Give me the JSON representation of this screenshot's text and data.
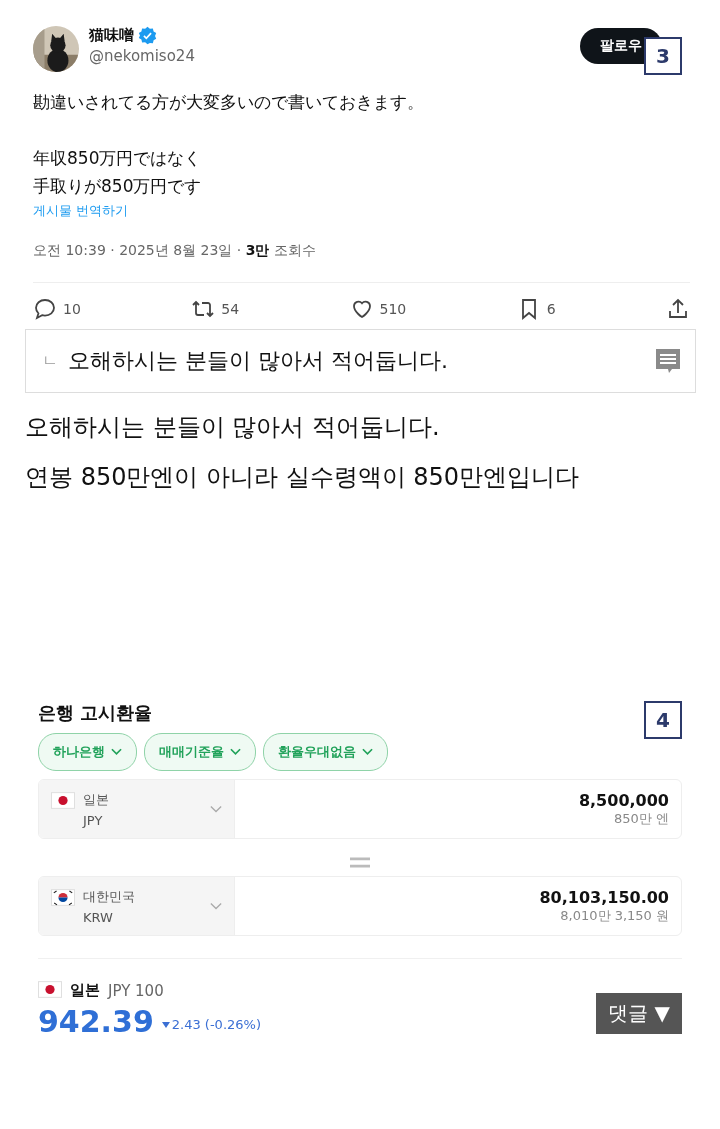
{
  "tweet": {
    "name": "猫味噌",
    "verified": true,
    "handle": "@nekomiso24",
    "follow_button": "팔로우",
    "image_number": "3",
    "body_paragraphs": [
      [
        "勘違いされてる方が大変多いので書いておきます。"
      ],
      [
        "年収850万円ではなく",
        "手取りが850万円です"
      ]
    ],
    "translate_link": "게시물 번역하기",
    "timestamp": "오전 10:39 · 2025년 8월 23일 · ",
    "views_count": "3만",
    "views_label": "조회수",
    "actions": [
      {
        "kind": "reply",
        "count": "10"
      },
      {
        "kind": "repost",
        "count": "54"
      },
      {
        "kind": "like",
        "count": "510"
      },
      {
        "kind": "bookmark",
        "count": "6"
      },
      {
        "kind": "share"
      }
    ]
  },
  "quote": {
    "marker": "ㄴ",
    "text": "오해하시는 분들이 많아서 적어둡니다."
  },
  "post_paragraphs": [
    "오해하시는 분들이 많아서 적어둡니다.",
    "연봉 850만엔이 아니라 실수령액이 850만엔입니다"
  ],
  "exchange": {
    "title": "은행 고시환율",
    "image_number": "4",
    "filters": [
      "하나은행",
      "매매기준율",
      "환율우대없음"
    ],
    "rows": [
      {
        "kind": "jp",
        "country": "일본",
        "code": "JPY",
        "amount": "8,500,000",
        "amount_words": "850만 엔"
      },
      {
        "kind": "kr",
        "country": "대한민국",
        "code": "KRW",
        "amount": "80,103,150.00",
        "amount_words": "8,010만 3,150 원"
      }
    ],
    "rate": {
      "kind": "jp",
      "country": "일본",
      "unit": "JPY 100",
      "value": "942.39",
      "change": {
        "kind": "down",
        "text": "2.43 (-0.26%)"
      }
    }
  },
  "comment_button": "댓글 ▼"
}
